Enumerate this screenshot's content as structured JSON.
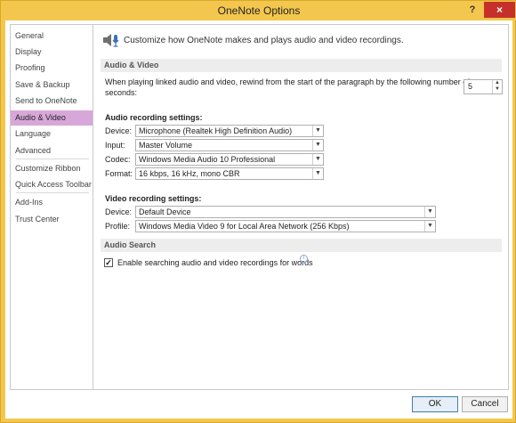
{
  "window": {
    "title": "OneNote Options",
    "help_label": "?",
    "close_label": "×"
  },
  "sidebar": {
    "items": [
      {
        "label": "General",
        "selected": false
      },
      {
        "label": "Display",
        "selected": false
      },
      {
        "label": "Proofing",
        "selected": false
      },
      {
        "label": "Save & Backup",
        "selected": false
      },
      {
        "label": "Send to OneNote",
        "selected": false
      },
      {
        "label": "Audio & Video",
        "selected": true
      },
      {
        "label": "Language",
        "selected": false
      },
      {
        "label": "Advanced",
        "selected": false
      },
      {
        "label": "Customize Ribbon",
        "selected": false
      },
      {
        "label": "Quick Access Toolbar",
        "selected": false
      },
      {
        "label": "Add-Ins",
        "selected": false
      },
      {
        "label": "Trust Center",
        "selected": false
      }
    ]
  },
  "main": {
    "intro": "Customize how OneNote makes and plays audio and video recordings.",
    "audio_video": {
      "heading": "Audio & Video",
      "rewind_label_line1": "When playing linked audio and video, rewind from the start of the paragraph by the following number of",
      "rewind_label_line2": "seconds:",
      "rewind_value": "5"
    },
    "audio_recording": {
      "heading": "Audio recording settings:",
      "device_label": "Device:",
      "device_value": "Microphone (Realtek High Definition Audio)",
      "input_label": "Input:",
      "input_value": "Master Volume",
      "codec_label": "Codec:",
      "codec_value": "Windows Media Audio 10 Professional",
      "format_label": "Format:",
      "format_value": "16 kbps, 16 kHz, mono CBR"
    },
    "video_recording": {
      "heading": "Video recording settings:",
      "device_label": "Device:",
      "device_value": "Default Device",
      "profile_label": "Profile:",
      "profile_value": "Windows Media Video 9 for Local Area Network (256 Kbps)"
    },
    "audio_search": {
      "heading": "Audio Search",
      "checkbox_label": "Enable searching audio and video recordings for words",
      "checked": true
    }
  },
  "footer": {
    "ok_label": "OK",
    "cancel_label": "Cancel"
  },
  "colors": {
    "title_bar": "#F3C74E",
    "selected_nav": "#D8A7D9",
    "close_button": "#C7302A"
  }
}
